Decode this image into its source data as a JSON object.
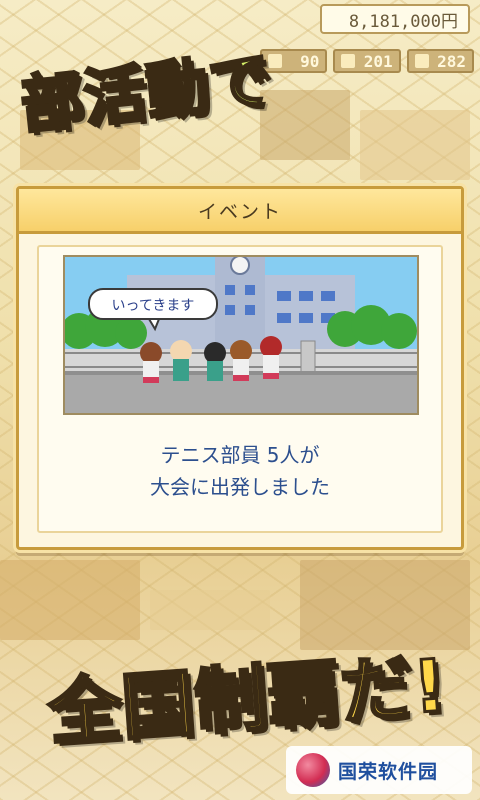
{
  "hud": {
    "money": "8,181,000円",
    "stats": [
      {
        "icon": "trophy-icon",
        "value": "90"
      },
      {
        "icon": "flask-icon",
        "value": "201"
      },
      {
        "icon": "weight-icon",
        "value": "282"
      }
    ]
  },
  "promo": {
    "top": "部活動で",
    "bottom": "全国制覇だ!"
  },
  "dialog": {
    "title": "イベント",
    "speech": "いってきます",
    "message_line1": "テニス部員 5人が",
    "message_line2": "大会に出発しました"
  },
  "watermark": {
    "text": "国荣软件园"
  },
  "colors": {
    "dialog_border": "#c79b3c",
    "header_bg": "#f7d06a",
    "message_text": "#2c4f8e",
    "promo_bottom": "#ffd84a",
    "promo_top": "#d6f26a"
  }
}
